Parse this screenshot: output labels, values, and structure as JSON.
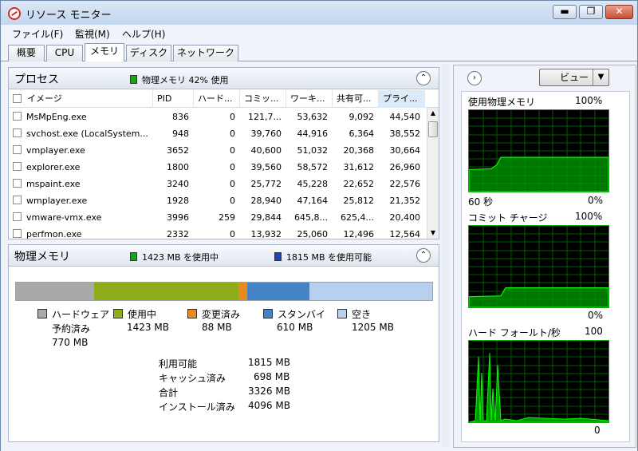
{
  "window": {
    "title": "リソース モニター",
    "min": "▬",
    "max": "❐",
    "close": "✕"
  },
  "menu": [
    "ファイル(F)",
    "監視(M)",
    "ヘルプ(H)"
  ],
  "tabs": [
    "概要",
    "CPU",
    "メモリ",
    "ディスク",
    "ネットワーク"
  ],
  "active_tab": "メモリ",
  "process": {
    "title": "プロセス",
    "summary": "物理メモリ 42% 使用",
    "columns": [
      "イメージ",
      "PID",
      "ハード...",
      "コミッ...",
      "ワーキ...",
      "共有可...",
      "プライ..."
    ],
    "rows": [
      [
        "MsMpEng.exe",
        "836",
        "0",
        "121,7...",
        "53,632",
        "9,092",
        "44,540"
      ],
      [
        "svchost.exe (LocalSystem...",
        "948",
        "0",
        "39,760",
        "44,916",
        "6,364",
        "38,552"
      ],
      [
        "vmplayer.exe",
        "3652",
        "0",
        "40,600",
        "51,032",
        "20,368",
        "30,664"
      ],
      [
        "explorer.exe",
        "1800",
        "0",
        "39,560",
        "58,572",
        "31,612",
        "26,960"
      ],
      [
        "mspaint.exe",
        "3240",
        "0",
        "25,772",
        "45,228",
        "22,652",
        "22,576"
      ],
      [
        "wmplayer.exe",
        "1928",
        "0",
        "28,940",
        "47,164",
        "25,812",
        "21,352"
      ],
      [
        "vmware-vmx.exe",
        "3996",
        "259",
        "29,844",
        "645,8...",
        "625,4...",
        "20,400"
      ],
      [
        "perfmon.exe",
        "2332",
        "0",
        "13,932",
        "25,060",
        "12,496",
        "12,564"
      ]
    ]
  },
  "memory": {
    "title": "物理メモリ",
    "in_use_summary": "1423 MB を使用中",
    "available_summary": "1815 MB を使用可能",
    "segments": [
      {
        "name": "ハードウェア予約済み",
        "mb": 770,
        "color": "#a9a9a9"
      },
      {
        "name": "使用中",
        "mb": 1423,
        "color": "#8fad1b"
      },
      {
        "name": "変更済み",
        "mb": 88,
        "color": "#e98a1d"
      },
      {
        "name": "スタンバイ",
        "mb": 610,
        "color": "#4484c6"
      },
      {
        "name": "空き",
        "mb": 1205,
        "color": "#b7d0ef"
      }
    ],
    "legend": {
      "hw_line1": "ハードウェア",
      "hw_line2": "予約済み",
      "hw_value": "770 MB",
      "inuse_label": "使用中",
      "inuse_value": "1423 MB",
      "modified_label": "変更済み",
      "modified_value": "88 MB",
      "standby_label": "スタンバイ",
      "standby_value": "610 MB",
      "free_label": "空き",
      "free_value": "1205 MB"
    },
    "stats": [
      {
        "label": "利用可能",
        "value": "1815 MB"
      },
      {
        "label": "キャッシュ済み",
        "value": "698 MB"
      },
      {
        "label": "合計",
        "value": "3326 MB"
      },
      {
        "label": "インストール済み",
        "value": "4096 MB"
      }
    ]
  },
  "right": {
    "view_label": "ビュー",
    "graphs": [
      {
        "title": "使用物理メモリ",
        "max": "100%",
        "bottom_left": "60 秒",
        "bottom_right": "0%",
        "level": 0.42
      },
      {
        "title": "コミット チャージ",
        "max": "100%",
        "bottom_left": "",
        "bottom_right": "0%",
        "level": 0.24
      },
      {
        "title": "ハード フォールト/秒",
        "max": "100",
        "bottom_left": "",
        "bottom_right": "0",
        "level": 0.0
      }
    ]
  },
  "colors": {
    "in_use_square": "#1aa31a",
    "available_square": "#1e3fc6",
    "graph_green": "#00ff00"
  }
}
